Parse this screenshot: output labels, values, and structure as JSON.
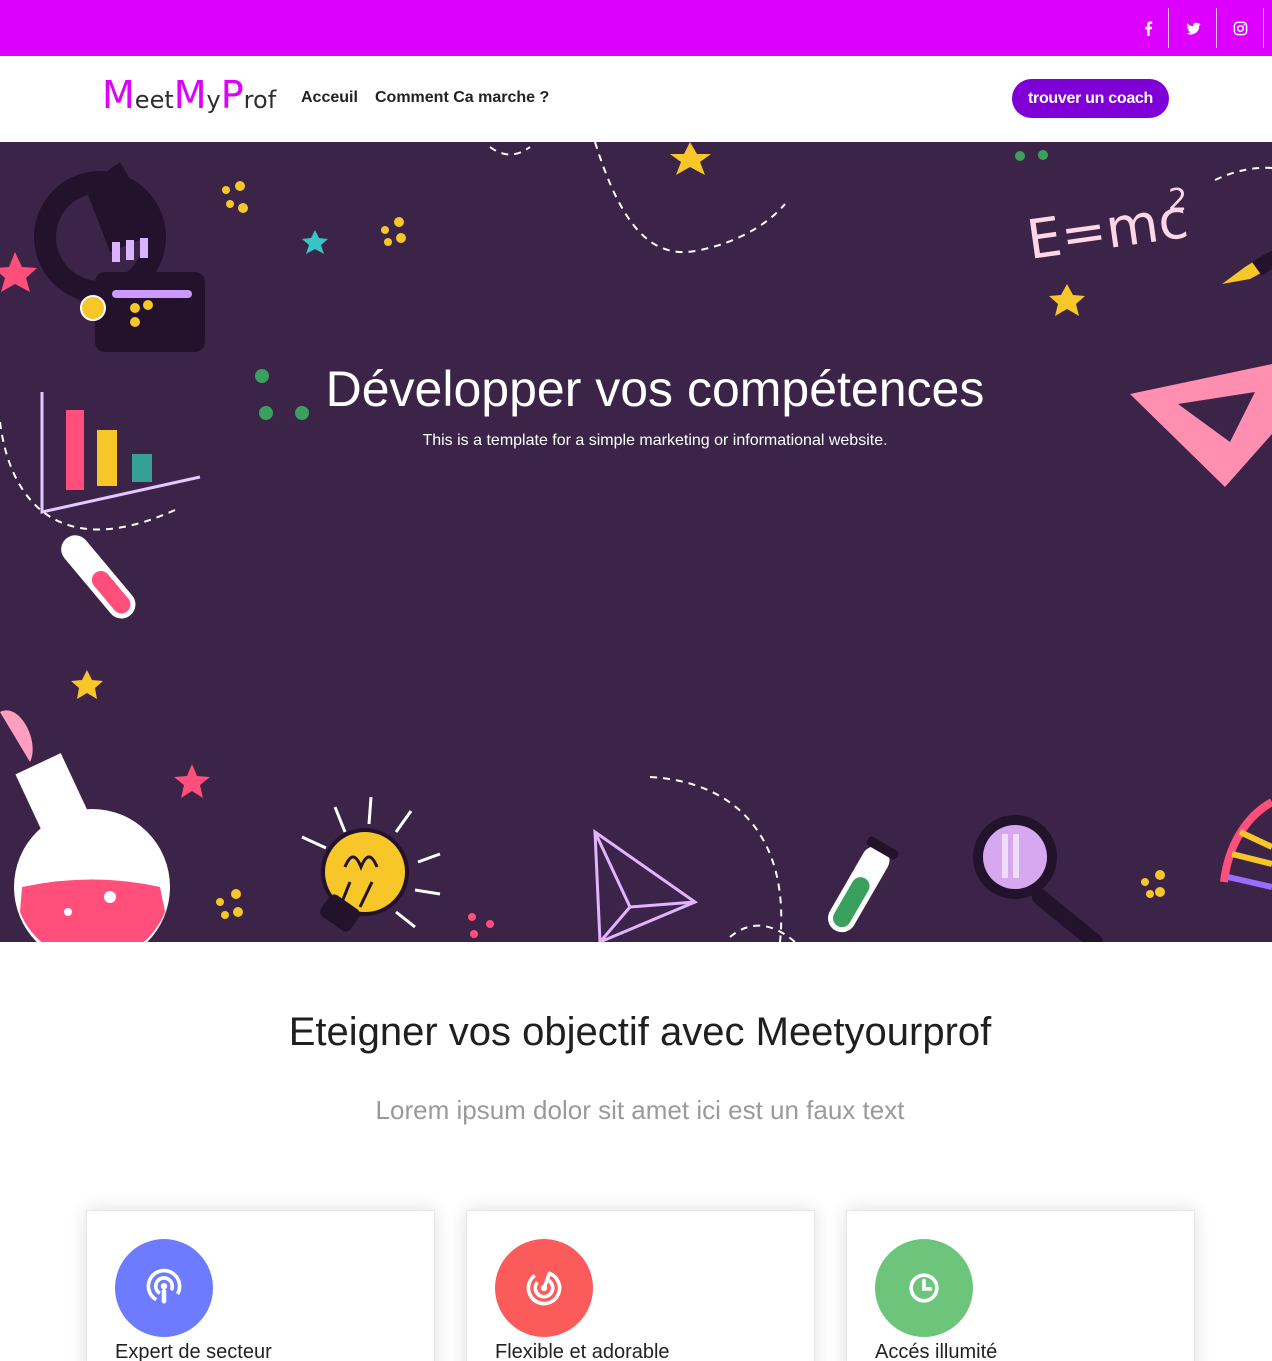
{
  "topbar": {
    "socials": [
      {
        "icon": "facebook-icon"
      },
      {
        "icon": "twitter-icon"
      },
      {
        "icon": "instagram-icon"
      }
    ]
  },
  "nav": {
    "brand": {
      "p1": "M",
      "p2": "eet",
      "p3": "M",
      "p4": "y",
      "p5": "P",
      "p6": "rof"
    },
    "links": [
      "Acceuil",
      "Comment Ca marche ?"
    ],
    "cta": "trouver un coach"
  },
  "hero": {
    "title": "Développer vos compétences",
    "subtitle": "This is a template for a simple marketing or informational website.",
    "formula": "E=mc",
    "exponent": "2"
  },
  "section": {
    "title_bold": "Eteigner vos objectif avec Meet",
    "title_light": "yourprof",
    "subtitle": "Lorem ipsum dolor sit amet ici est un faux text"
  },
  "features": [
    {
      "title": "Expert de secteur",
      "icon": "podcast-icon",
      "color": "#6c7bff"
    },
    {
      "title": "Flexible et adorable",
      "icon": "target-icon",
      "color": "#fb5b5a"
    },
    {
      "title": "Accés illumité",
      "icon": "clock-icon",
      "color": "#6cc57a"
    }
  ],
  "colors": {
    "accent": "#dd00ff",
    "button": "#7f00d6",
    "hero_bg": "#3b2448"
  }
}
